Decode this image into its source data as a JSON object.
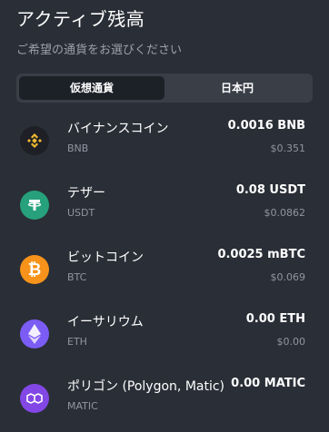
{
  "header": {
    "title": "アクティブ残高",
    "subtitle": "ご希望の通貨をお選びください"
  },
  "tabs": [
    {
      "label": "仮想通貨",
      "active": true
    },
    {
      "label": "日本円",
      "active": false
    }
  ],
  "assets": [
    {
      "name": "バイナンスコイン",
      "symbol": "BNB",
      "amount": "0.0016 BNB",
      "fiat": "$0.351",
      "icon": "bnb-icon",
      "icon_color": "#1e2026",
      "icon_fg": "#f3ba2f"
    },
    {
      "name": "テザー",
      "symbol": "USDT",
      "amount": "0.08 USDT",
      "fiat": "$0.0862",
      "icon": "tether-icon",
      "icon_color": "#26a17b",
      "icon_fg": "#ffffff"
    },
    {
      "name": "ビットコイン",
      "symbol": "BTC",
      "amount": "0.0025 mBTC",
      "fiat": "$0.069",
      "icon": "bitcoin-icon",
      "icon_color": "#f7931a",
      "icon_fg": "#ffffff"
    },
    {
      "name": "イーサリウム",
      "symbol": "ETH",
      "amount": "0.00 ETH",
      "fiat": "$0.00",
      "icon": "ethereum-icon",
      "icon_color": "#7b5cf5",
      "icon_fg": "#ffffff"
    },
    {
      "name": "ポリゴン (Polygon, Matic)",
      "symbol": "MATIC",
      "amount": "0.00 MATIC",
      "fiat": "",
      "icon": "polygon-icon",
      "icon_color": "#8247e5",
      "icon_fg": "#ffffff"
    }
  ]
}
